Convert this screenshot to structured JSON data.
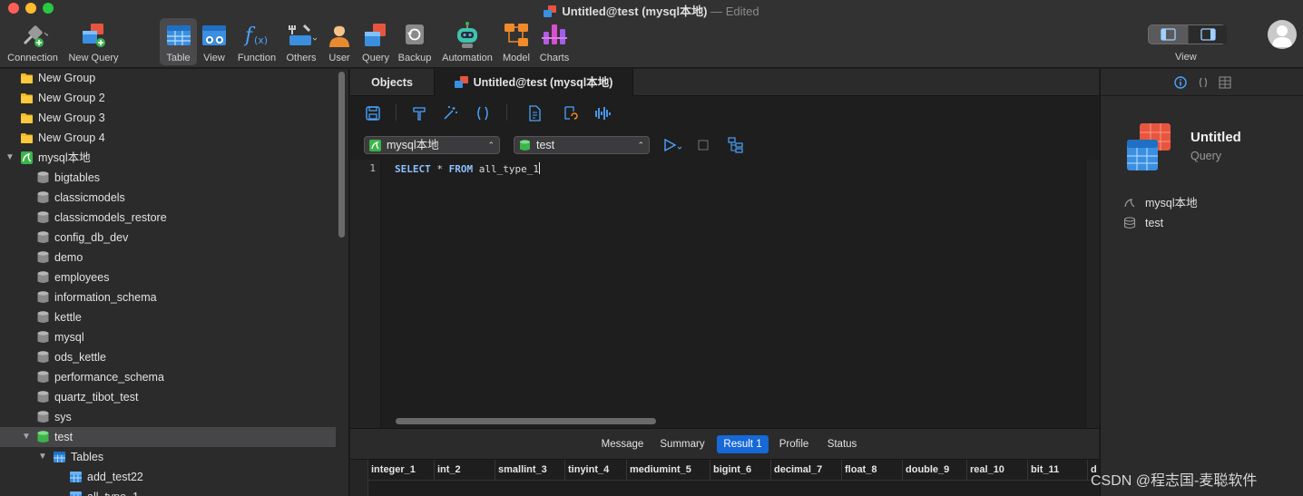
{
  "window": {
    "title": "Untitled@test (mysql本地)",
    "edited": "— Edited"
  },
  "toolbar": [
    {
      "label": "Connection",
      "icon": "connection-icon"
    },
    {
      "label": "New Query",
      "icon": "new-query-icon"
    },
    {
      "label": "Table",
      "icon": "table-icon"
    },
    {
      "label": "View",
      "icon": "view-icon"
    },
    {
      "label": "Function",
      "icon": "function-icon"
    },
    {
      "label": "Others",
      "icon": "others-icon"
    },
    {
      "label": "User",
      "icon": "user-icon"
    },
    {
      "label": "Query",
      "icon": "query-icon"
    },
    {
      "label": "Backup",
      "icon": "backup-icon"
    },
    {
      "label": "Automation",
      "icon": "automation-icon"
    },
    {
      "label": "Model",
      "icon": "model-icon"
    },
    {
      "label": "Charts",
      "icon": "charts-icon"
    }
  ],
  "view_label": "View",
  "sidebar": {
    "groups": [
      "New Group",
      "New Group 2",
      "New Group 3",
      "New Group 4"
    ],
    "connection": "mysql本地",
    "databases": [
      "bigtables",
      "classicmodels",
      "classicmodels_restore",
      "config_db_dev",
      "demo",
      "employees",
      "information_schema",
      "kettle",
      "mysql",
      "ods_kettle",
      "performance_schema",
      "quartz_tibot_test",
      "sys"
    ],
    "open_database": "test",
    "tables_folder": "Tables",
    "tables": [
      "add_test22",
      "all_type_1"
    ]
  },
  "tabs": {
    "objects": "Objects",
    "query": "Untitled@test (mysql本地)"
  },
  "selectors": {
    "connection": "mysql本地",
    "database": "test"
  },
  "editor": {
    "line_number": "1",
    "keyword_select": "SELECT",
    "star": " * ",
    "keyword_from": "FROM",
    "rest": " all_type_1"
  },
  "result_tabs": [
    "Message",
    "Summary",
    "Result 1",
    "Profile",
    "Status"
  ],
  "active_result_tab": "Result 1",
  "columns": [
    "integer_1",
    "int_2",
    "smallint_3",
    "tinyint_4",
    "mediumint_5",
    "bigint_6",
    "decimal_7",
    "float_8",
    "double_9",
    "real_10",
    "bit_11",
    "d"
  ],
  "right_panel": {
    "title": "Untitled",
    "subtitle": "Query",
    "connection": "mysql本地",
    "database": "test"
  },
  "watermark": "CSDN @程志国-麦聪软件",
  "colors": {
    "accent": "#1669d6",
    "db_green": "#3bb54a",
    "query_red": "#e8553e",
    "table_blue": "#3a8fe0"
  }
}
